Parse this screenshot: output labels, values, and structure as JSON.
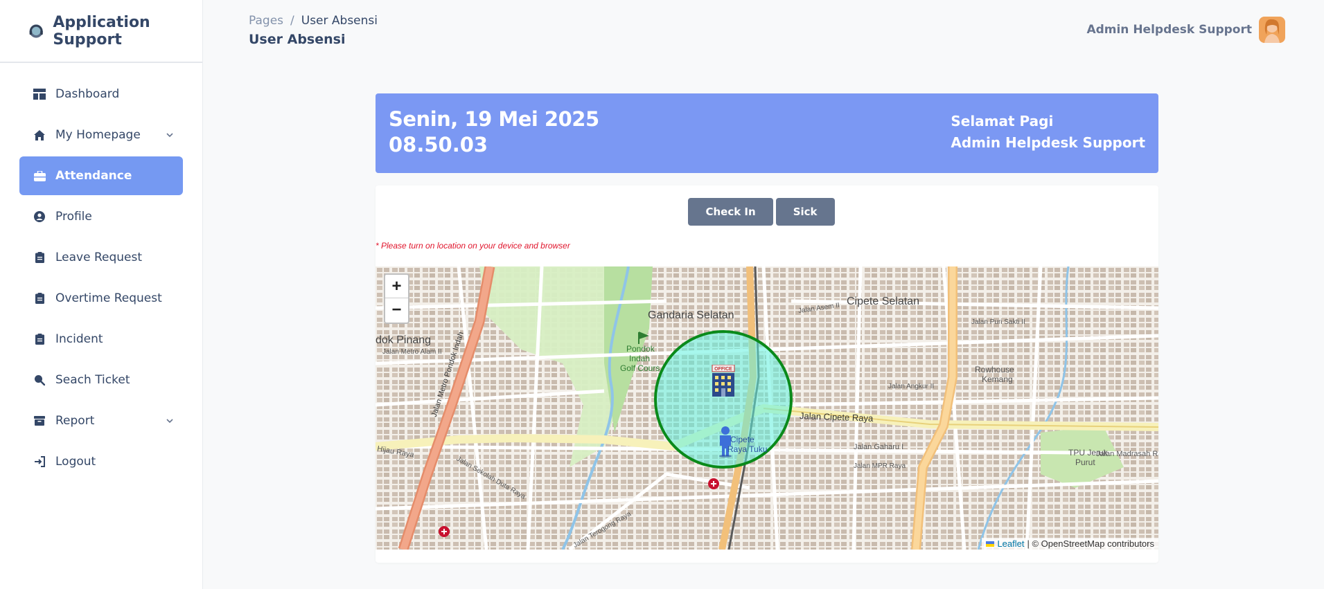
{
  "brand": {
    "name": "Application Support"
  },
  "sidebar": {
    "items": [
      {
        "label": "Dashboard",
        "icon": "dashboard-icon"
      },
      {
        "label": "My Homepage",
        "icon": "home-icon",
        "expandable": true
      },
      {
        "label": "Attendance",
        "icon": "briefcase-icon",
        "active": true
      },
      {
        "label": "Profile",
        "icon": "user-circle-icon"
      },
      {
        "label": "Leave Request",
        "icon": "clipboard-icon"
      },
      {
        "label": "Overtime Request",
        "icon": "clipboard-icon"
      },
      {
        "label": "Incident",
        "icon": "clipboard-icon"
      },
      {
        "label": "Seach Ticket",
        "icon": "search-icon"
      },
      {
        "label": "Report",
        "icon": "archive-icon",
        "expandable": true
      },
      {
        "label": "Logout",
        "icon": "logout-icon"
      }
    ]
  },
  "header": {
    "breadcrumb": {
      "root": "Pages",
      "separator": "/",
      "current": "User Absensi"
    },
    "title": "User Absensi",
    "user_name": "Admin Helpdesk Support"
  },
  "date_card": {
    "date": "Senin, 19 Mei 2025",
    "time": "08.50.03",
    "greeting": "Selamat Pagi",
    "user_name": "Admin Helpdesk Support"
  },
  "actions": {
    "check_in": "Check In",
    "sick": "Sick"
  },
  "warning": "* Please turn on location on your device and browser",
  "map": {
    "zoom_in": "+",
    "zoom_out": "−",
    "attribution_leaflet": "Leaflet",
    "attribution_rest": "| © OpenStreetMap contributors",
    "labels": {
      "area1": "Gandaria Selatan",
      "area2": "Cipete Selatan",
      "area3": "dok Pinang",
      "poi1": "Rowhouse",
      "poi1b": "Kemang",
      "poi2": "Pondok",
      "poi2b": "Indah",
      "poi2c": "Golf Cours",
      "poi3": "TPU Jeruk",
      "poi3b": "Purut",
      "road1": "Jalan Cipete Raya",
      "road2": "Jalan Metro Pondok Indah",
      "road3": "Jalan Sekolah Duta Raya",
      "road4": "Jalan Gaharu I",
      "road5": "Jalan Madrasah Raya",
      "road6": "Jalan Terogong Raya",
      "road7": "Jalan Asem II",
      "road8": "Jalan Puri Sakti II",
      "road9": "Jalan Angkur II",
      "road10": "Jalan MPR Raya",
      "road11": "Hijau Raya",
      "road12": "Jalan Metro Alam II",
      "station": "Cipete",
      "station2": "Raya Tuku",
      "office": "OFFICE"
    },
    "colors": {
      "geofence": "#0a8a1a",
      "geofence_fill": "#5ef0de",
      "arterial": "#f29b7a",
      "primary": "#f0c27a",
      "park": "#c8e6b0"
    }
  }
}
